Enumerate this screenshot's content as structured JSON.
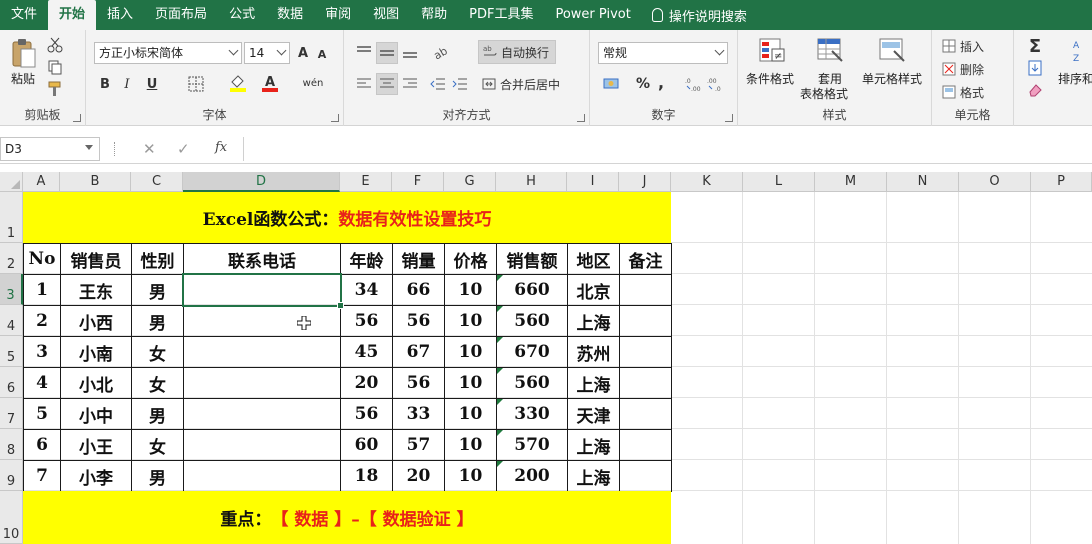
{
  "tabs": [
    "文件",
    "开始",
    "插入",
    "页面布局",
    "公式",
    "数据",
    "审阅",
    "视图",
    "帮助",
    "PDF工具集",
    "Power Pivot"
  ],
  "active_tab": "开始",
  "tell_me": "操作说明搜索",
  "ribbon": {
    "clipboard": {
      "paste": "粘贴",
      "label": "剪贴板"
    },
    "font": {
      "name": "方正小标宋简体",
      "size": "14",
      "bold": "B",
      "italic": "I",
      "underline": "U",
      "grow": "A",
      "shrink": "A",
      "wen": "wén",
      "label": "字体"
    },
    "alignment": {
      "wrap": "自动换行",
      "merge": "合并后居中",
      "label": "对齐方式"
    },
    "number": {
      "format": "常规",
      "percent": "%",
      "comma": ",",
      "label": "数字"
    },
    "styles": {
      "conditional": "条件格式",
      "table_format_1": "套用",
      "table_format_2": "表格格式",
      "cell_styles": "单元格样式",
      "label": "样式"
    },
    "cells": {
      "insert": "插入",
      "delete": "删除",
      "format": "格式",
      "label": "单元格"
    },
    "editing": {
      "sort": "排序和"
    }
  },
  "formula_bar": {
    "name_box": "D3",
    "cancel": "✕",
    "confirm": "✓",
    "fx": "fx",
    "formula": ""
  },
  "columns": [
    "A",
    "B",
    "C",
    "D",
    "E",
    "F",
    "G",
    "H",
    "I",
    "J",
    "K",
    "L",
    "M",
    "N",
    "O",
    "P"
  ],
  "selected_column": "D",
  "rows": [
    "1",
    "2",
    "3",
    "4",
    "5",
    "6",
    "7",
    "8",
    "9",
    "10"
  ],
  "selected_row": "3",
  "title_black": "Excel函数公式：",
  "title_red": "数据有效性设置技巧",
  "headers": [
    "No",
    "销售员",
    "性别",
    "联系电话",
    "年龄",
    "销量",
    "价格",
    "销售额",
    "地区",
    "备注"
  ],
  "data_rows": [
    [
      "1",
      "王东",
      "男",
      "",
      "34",
      "66",
      "10",
      "660",
      "北京",
      ""
    ],
    [
      "2",
      "小西",
      "男",
      "",
      "56",
      "56",
      "10",
      "560",
      "上海",
      ""
    ],
    [
      "3",
      "小南",
      "女",
      "",
      "45",
      "67",
      "10",
      "670",
      "苏州",
      ""
    ],
    [
      "4",
      "小北",
      "女",
      "",
      "20",
      "56",
      "10",
      "560",
      "上海",
      ""
    ],
    [
      "5",
      "小中",
      "男",
      "",
      "56",
      "33",
      "10",
      "330",
      "天津",
      ""
    ],
    [
      "6",
      "小王",
      "女",
      "",
      "60",
      "57",
      "10",
      "570",
      "上海",
      ""
    ],
    [
      "7",
      "小李",
      "男",
      "",
      "18",
      "20",
      "10",
      "200",
      "上海",
      ""
    ]
  ],
  "footer_black": "重点：",
  "footer_red": "【 数据 】–【 数据验证 】",
  "colors": {
    "excel_green": "#217346",
    "banner_yellow": "#ffff00",
    "title_red": "#e8221a"
  }
}
